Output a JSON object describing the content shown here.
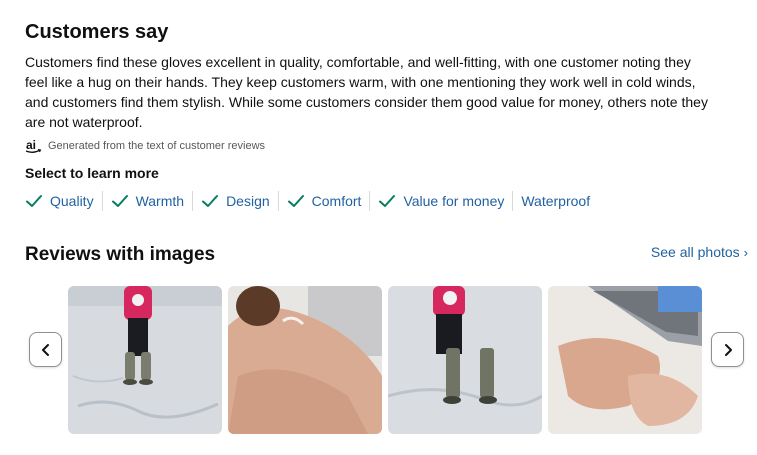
{
  "customers_say": {
    "title": "Customers say",
    "summary": "Customers find these gloves excellent in quality, comfortable, and well-fitting, with one customer noting they feel like a hug on their hands. They keep customers warm, with one mentioning they work well in cold winds, and customers find them stylish. While some customers consider them good value for money, others note they are not waterproof.",
    "ai_note": "Generated from the text of customer reviews",
    "select_label": "Select to learn more",
    "aspects": [
      {
        "label": "Quality",
        "checked": true
      },
      {
        "label": "Warmth",
        "checked": true
      },
      {
        "label": "Design",
        "checked": true
      },
      {
        "label": "Comfort",
        "checked": true
      },
      {
        "label": "Value for money",
        "checked": true
      },
      {
        "label": "Waterproof",
        "checked": false
      }
    ]
  },
  "reviews_with_images": {
    "title": "Reviews with images",
    "see_all": "See all photos",
    "images": [
      {
        "icon": "child-in-snow-photo"
      },
      {
        "icon": "glove-closeup-photo"
      },
      {
        "icon": "child-in-snow-photo"
      },
      {
        "icon": "gloves-on-laptop-photo"
      }
    ]
  },
  "colors": {
    "link": "#2162a1",
    "check": "#067d62",
    "text": "#0f1111"
  }
}
